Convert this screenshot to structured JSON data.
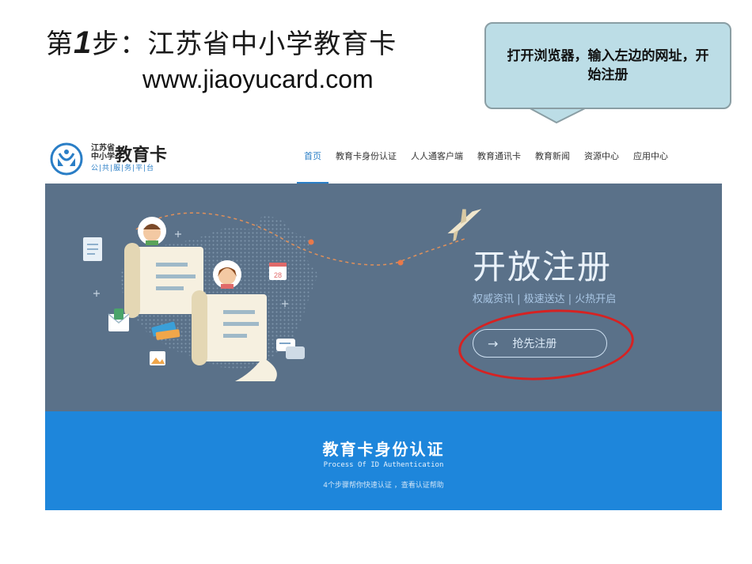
{
  "slide": {
    "step_prefix": "第",
    "step_number": "1",
    "step_suffix": "步：江苏省中小学教育卡",
    "url": "www.jiaoyucard.com"
  },
  "callout": {
    "text": "打开浏览器，输入左边的网址，开始注册"
  },
  "site": {
    "logo": {
      "small_line1": "江苏省",
      "small_line2": "中小学",
      "big": "教育卡",
      "sub": "公|共|服|务|平|台"
    },
    "nav": [
      {
        "label": "首页",
        "active": true
      },
      {
        "label": "教育卡身份认证",
        "active": false
      },
      {
        "label": "人人通客户端",
        "active": false
      },
      {
        "label": "教育通讯卡",
        "active": false
      },
      {
        "label": "教育新闻",
        "active": false
      },
      {
        "label": "资源中心",
        "active": false
      },
      {
        "label": "应用中心",
        "active": false
      }
    ],
    "banner": {
      "title": "开放注册",
      "subtitle": "权威资讯 | 极速送达 | 火热开启",
      "cta_arrow": "→",
      "cta_label": "抢先注册",
      "calendar_day": "28"
    },
    "auth": {
      "title": "教育卡身份认证",
      "subtitle_en": "Process Of ID Authentication",
      "desc": "4个步骤帮你快速认证 ，查看认证帮助"
    }
  },
  "colors": {
    "banner_bg": "#5a7189",
    "auth_bg": "#1e86db",
    "nav_active": "#2a7ec6",
    "highlight_ring": "#d62222",
    "callout_bg": "#bcdde6"
  }
}
